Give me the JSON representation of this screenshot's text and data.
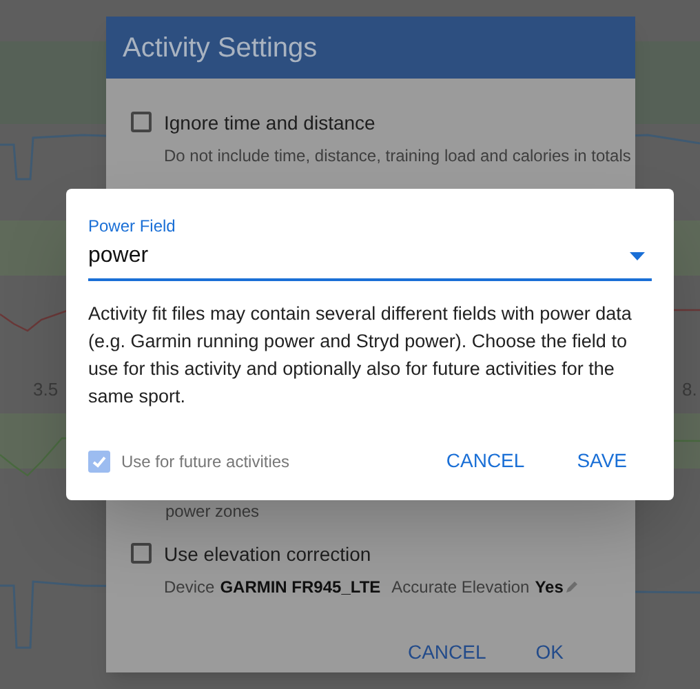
{
  "background": {
    "tick_labels": [
      "3.5",
      "8."
    ]
  },
  "settings_dialog": {
    "title": "Activity Settings",
    "options": [
      {
        "label": "Ignore time and distance",
        "description": "Do not include time, distance, training load and calories in totals",
        "checked": false
      }
    ],
    "hidden_option_tail": "power zones",
    "elevation": {
      "label": "Use elevation correction",
      "checked": false,
      "device_label": "Device",
      "device": "GARMIN FR945_LTE",
      "accuracy_label": "Accurate Elevation",
      "accuracy": "Yes"
    },
    "buttons": [
      "CANCEL",
      "OK"
    ]
  },
  "power_dialog": {
    "field_label": "Power Field",
    "value": "power",
    "description": "Activity fit files may contain several different fields with power data (e.g. Garmin running power and Stryd power). Choose the field to use for this activity and optionally also for future activities for the same sport.",
    "future": {
      "label": "Use for future activities",
      "checked": true,
      "disabled": true
    },
    "buttons": [
      "CANCEL",
      "SAVE"
    ]
  }
}
